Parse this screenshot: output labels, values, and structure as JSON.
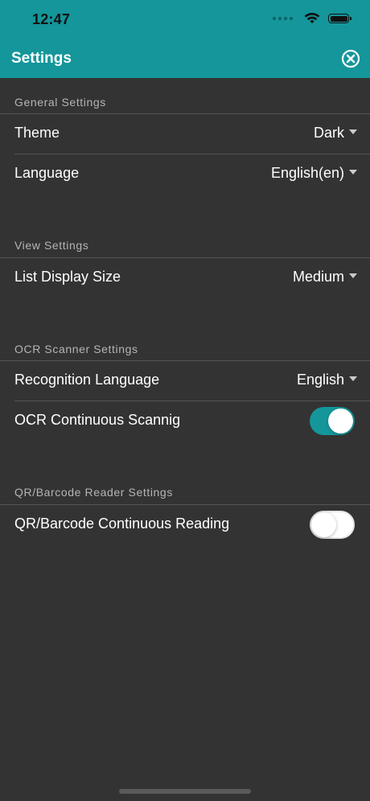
{
  "status_bar": {
    "time": "12:47"
  },
  "header": {
    "title": "Settings",
    "accent_color": "#14969a"
  },
  "sections": {
    "general": {
      "header": "General Settings",
      "theme": {
        "label": "Theme",
        "value": "Dark"
      },
      "language": {
        "label": "Language",
        "value": "English(en)"
      }
    },
    "view": {
      "header": "View Settings",
      "list_display_size": {
        "label": "List Display Size",
        "value": "Medium"
      }
    },
    "ocr": {
      "header": "OCR Scanner Settings",
      "recognition_language": {
        "label": "Recognition Language",
        "value": "English"
      },
      "continuous_scanning": {
        "label": "OCR Continuous Scannig",
        "enabled": true
      }
    },
    "qr": {
      "header": "QR/Barcode Reader Settings",
      "continuous_reading": {
        "label": "QR/Barcode Continuous Reading",
        "enabled": false
      }
    }
  },
  "icons": {
    "close": "close-circle-icon",
    "wifi": "wifi-icon",
    "battery": "battery-icon",
    "dropdown": "caret-down-icon"
  }
}
